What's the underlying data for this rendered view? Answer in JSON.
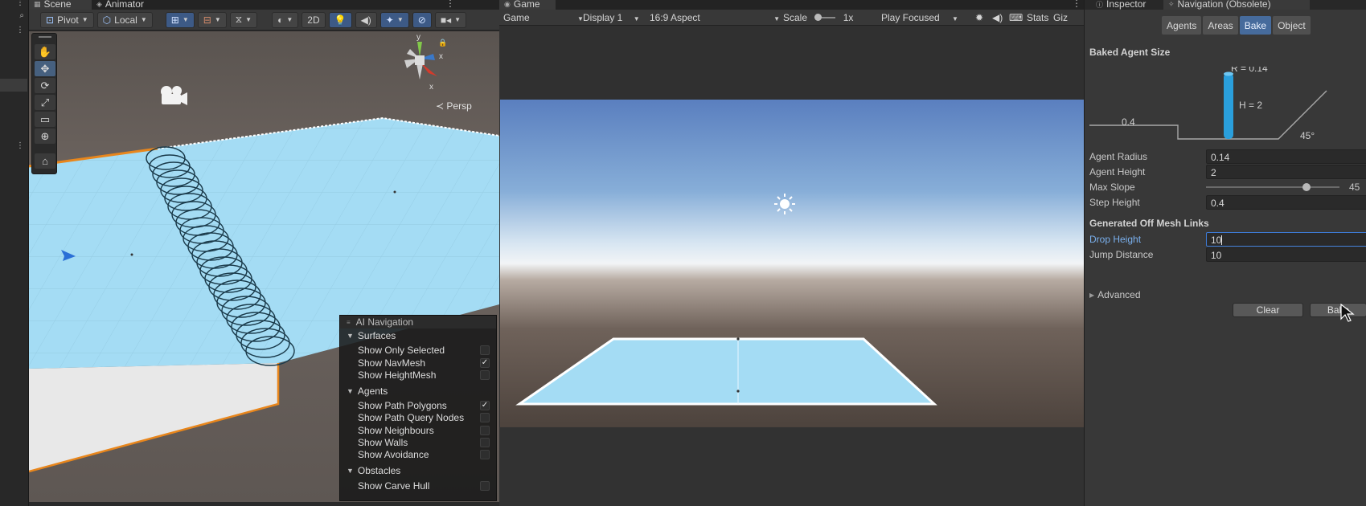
{
  "left_strip": {
    "items": [
      "⋮",
      "⌕",
      "⋮",
      "⋮"
    ]
  },
  "scene": {
    "tabs": [
      {
        "label": "Scene",
        "icon": "grid-icon"
      },
      {
        "label": "Animator",
        "icon": "animator-icon"
      }
    ],
    "toolbar": {
      "pivot": "Pivot",
      "local": "Local",
      "mode_2d": "2D"
    },
    "tools": [
      "hand-tool",
      "move-tool",
      "rotate-tool",
      "scale-tool",
      "rect-tool",
      "transform-tool",
      "custom-tool"
    ],
    "persp_label": "≺ Persp",
    "gizmo": {
      "x": "x",
      "y": "y"
    }
  },
  "ai_navigation": {
    "title": "AI Navigation",
    "sections": [
      {
        "name": "Surfaces",
        "rows": [
          {
            "label": "Show Only Selected",
            "checked": false
          },
          {
            "label": "Show NavMesh",
            "checked": true
          },
          {
            "label": "Show HeightMesh",
            "checked": false
          }
        ]
      },
      {
        "name": "Agents",
        "rows": [
          {
            "label": "Show Path Polygons",
            "checked": true
          },
          {
            "label": "Show Path Query Nodes",
            "checked": false
          },
          {
            "label": "Show Neighbours",
            "checked": false
          },
          {
            "label": "Show Walls",
            "checked": false
          },
          {
            "label": "Show Avoidance",
            "checked": false
          }
        ]
      },
      {
        "name": "Obstacles",
        "rows": [
          {
            "label": "Show Carve Hull",
            "checked": false
          }
        ]
      }
    ]
  },
  "game": {
    "tab": "Game",
    "toolbar": {
      "view": "Game",
      "display": "Display 1",
      "aspect": "16:9 Aspect",
      "scale_label": "Scale",
      "scale_value": "1x",
      "play_mode": "Play Focused",
      "stats": "Stats",
      "gizmos": "Giz"
    }
  },
  "inspector": {
    "tabs": [
      "Inspector",
      "Navigation (Obsolete)"
    ],
    "nav_tabs": [
      "Agents",
      "Areas",
      "Bake",
      "Object"
    ],
    "active_nav_tab": "Bake",
    "baked_agent_size": {
      "title": "Baked Agent Size",
      "radius_label": "R = 0.14",
      "height_label": "H = 2",
      "step_label": "0.4",
      "slope_label": "45°"
    },
    "fields": {
      "agent_radius": {
        "label": "Agent Radius",
        "value": "0.14"
      },
      "agent_height": {
        "label": "Agent Height",
        "value": "2"
      },
      "max_slope": {
        "label": "Max Slope",
        "value": "45",
        "fraction": 0.75
      },
      "step_height": {
        "label": "Step Height",
        "value": "0.4"
      }
    },
    "off_mesh": {
      "title": "Generated Off Mesh Links",
      "drop_height": {
        "label": "Drop Height",
        "value": "10"
      },
      "jump_distance": {
        "label": "Jump Distance",
        "value": "10"
      }
    },
    "advanced": "Advanced",
    "buttons": {
      "clear": "Clear",
      "bake": "Bake"
    }
  },
  "colors": {
    "navmesh": "#a4dcf4",
    "selection_outline": "#e8861c",
    "accent_blue": "#466b9c",
    "agent_cylinder": "#2a9fdc"
  }
}
